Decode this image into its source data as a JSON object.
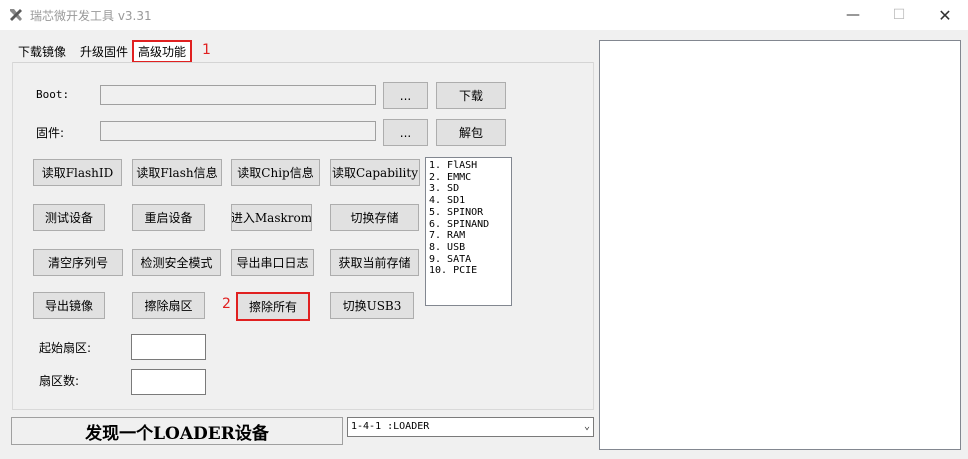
{
  "window": {
    "title": "瑞芯微开发工具 v3.31",
    "controls": {
      "minimize": "—",
      "maximize": "☐",
      "close": "✕"
    }
  },
  "tabs": [
    {
      "label": "下载镜像"
    },
    {
      "label": "升级固件"
    },
    {
      "label": "高级功能",
      "active": true
    }
  ],
  "annotations": {
    "marker1": "1",
    "marker2": "2"
  },
  "boot": {
    "label": "Boot:",
    "value": "",
    "browse_label": "...",
    "download_label": "下载"
  },
  "firmware": {
    "label": "固件:",
    "value": "",
    "browse_label": "...",
    "unpack_label": "解包"
  },
  "buttons": {
    "read_flash_id": "读取FlashID",
    "read_flash_info": "读取Flash信息",
    "read_chip_info": "读取Chip信息",
    "read_capability": "读取Capability",
    "test_device": "测试设备",
    "reboot_device": "重启设备",
    "enter_maskrom": "进入Maskrom",
    "switch_storage": "切换存储",
    "clear_serial": "清空序列号",
    "check_secure_mode": "检测安全模式",
    "export_serial_log": "导出串口日志",
    "get_current_storage": "获取当前存储",
    "export_image": "导出镜像",
    "erase_sectors": "擦除扇区",
    "erase_all": "擦除所有",
    "switch_usb3": "切换USB3"
  },
  "storage_list": [
    "1.  FlASH",
    "2.  EMMC",
    "3.  SD",
    "4.  SD1",
    "5.  SPINOR",
    "6.  SPINAND",
    "7.  RAM",
    "8.  USB",
    "9.  SATA",
    "10.  PCIE"
  ],
  "sector_inputs": {
    "start_label": "起始扇区:",
    "start_value": "",
    "count_label": "扇区数:",
    "count_value": ""
  },
  "status": {
    "message": "发现一个LOADER设备"
  },
  "device_select": {
    "selected": "1-4-1  :LOADER"
  },
  "colors": {
    "highlight": "#e02020",
    "background": "#f0f0f0",
    "button": "#e1e1e1"
  }
}
